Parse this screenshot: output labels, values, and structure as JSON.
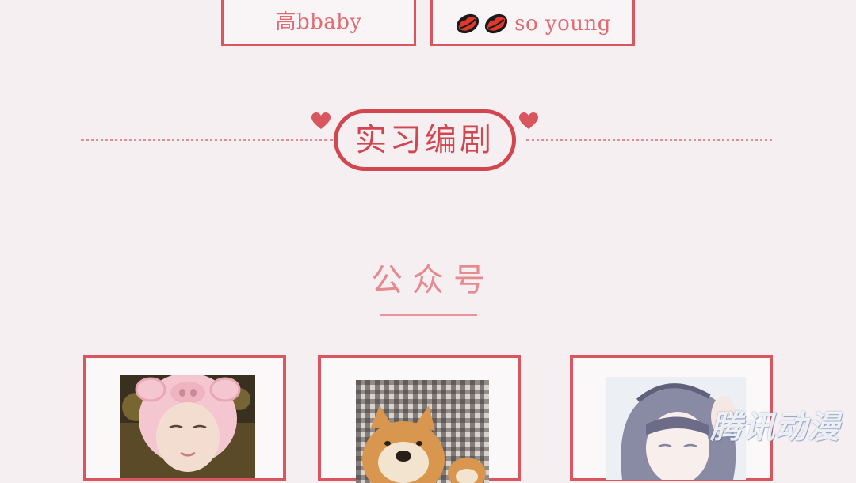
{
  "name_cards": {
    "left": {
      "name": "高bbaby"
    },
    "right": {
      "icons": [
        "lips-icon",
        "lips-icon"
      ],
      "name": "so young"
    }
  },
  "section": {
    "title": "实习编剧",
    "decorations": [
      "heart-icon",
      "heart-icon"
    ]
  },
  "sub_section": {
    "title": "公众号"
  },
  "photo_cards": [
    {
      "subject": "girl-in-pig-hat"
    },
    {
      "subject": "shiba-dog"
    },
    {
      "subject": "anime-girl"
    }
  ],
  "watermark": {
    "text": "腾讯动漫"
  },
  "colors": {
    "background": "#f6eff2",
    "accent": "#d1464f",
    "text_pink": "#e06c72",
    "border": "#d9565e"
  }
}
